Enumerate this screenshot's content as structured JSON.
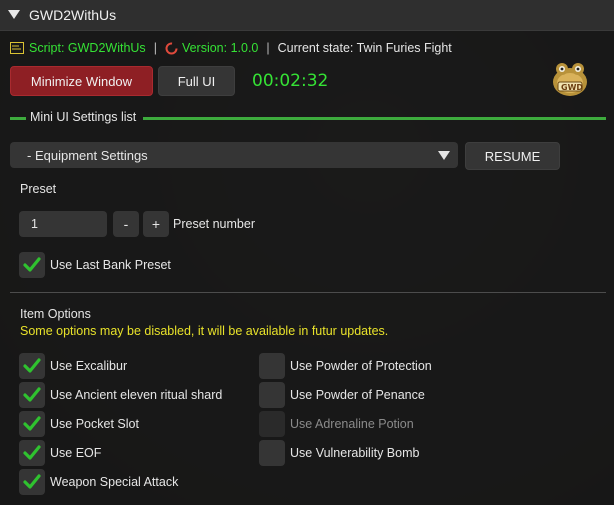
{
  "window": {
    "title": "GWD2WithUs"
  },
  "info": {
    "script_label": "Script: GWD2WithUs",
    "version_label": "Version: 1.0.0",
    "state_label": "Current state: Twin Furies Fight",
    "separator": "|"
  },
  "buttons": {
    "minimize": "Minimize Window",
    "full_ui": "Full UI",
    "resume": "RESUME"
  },
  "timer": "00:02:32",
  "logo_text": "GWD",
  "mini_ui": {
    "section_title": "Mini UI Settings list",
    "dropdown_value": "- Equipment Settings"
  },
  "preset": {
    "heading": "Preset",
    "value": "1",
    "minus": "-",
    "plus": "+",
    "number_label": "Preset number",
    "use_last_bank": {
      "label": "Use Last Bank Preset",
      "checked": true
    }
  },
  "item_options": {
    "heading": "Item Options",
    "note": "Some options may be disabled, it will be available in futur updates.",
    "left": [
      {
        "label": "Use Excalibur",
        "checked": true
      },
      {
        "label": "Use Ancient eleven ritual shard",
        "checked": true
      },
      {
        "label": "Use Pocket Slot",
        "checked": true
      },
      {
        "label": "Use EOF",
        "checked": true
      },
      {
        "label": "Weapon Special Attack",
        "checked": true
      }
    ],
    "right": [
      {
        "label": "Use Powder of Protection",
        "checked": false,
        "disabled": false
      },
      {
        "label": "Use Powder of Penance",
        "checked": false,
        "disabled": false
      },
      {
        "label": "Use Adrenaline Potion",
        "checked": false,
        "disabled": true
      },
      {
        "label": "Use Vulnerability Bomb",
        "checked": false,
        "disabled": false
      }
    ]
  },
  "colors": {
    "accent_green": "#35e235",
    "section_line": "#3dab3d",
    "minimize_red": "#8e1f24",
    "warning_yellow": "#e8e22a",
    "version_orange": "#e8a84c"
  },
  "icons": {
    "collapse": "triangle-down-icon",
    "script": "script-icon",
    "version": "refresh-icon",
    "dropdown": "chevron-down-icon",
    "checkbox": "checkmark-icon",
    "logo": "frog-logo-icon"
  }
}
